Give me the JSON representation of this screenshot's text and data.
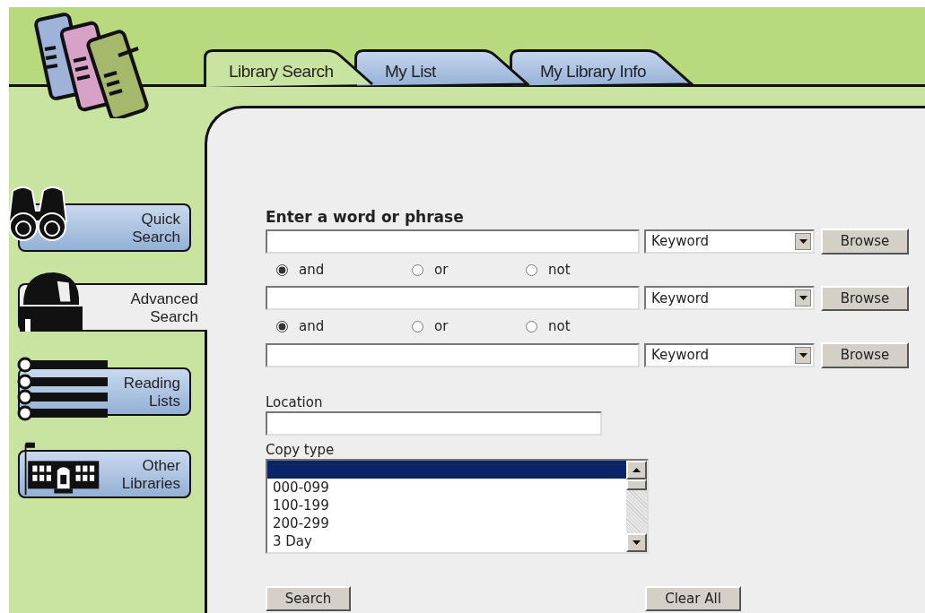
{
  "tabs": [
    {
      "label": "Library Search",
      "selected": true
    },
    {
      "label": "My List",
      "selected": false
    },
    {
      "label": "My Library Info",
      "selected": false
    }
  ],
  "sidebar": {
    "items": [
      {
        "label": "Quick Search",
        "kind": "binoculars",
        "selected": false
      },
      {
        "label": "Advanced Search",
        "kind": "observatory",
        "selected": true
      },
      {
        "label": "Reading Lists",
        "kind": "list",
        "selected": false
      },
      {
        "label": "Other Libraries",
        "kind": "building",
        "selected": false
      }
    ]
  },
  "search": {
    "heading": "Enter a word or phrase",
    "terms": [
      {
        "field_type": "Keyword",
        "button": "Browse"
      },
      {
        "field_type": "Keyword",
        "button": "Browse"
      },
      {
        "field_type": "Keyword",
        "button": "Browse"
      }
    ],
    "operators": [
      {
        "options": [
          {
            "label": "and",
            "selected": true
          },
          {
            "label": "or",
            "selected": false
          },
          {
            "label": "not",
            "selected": false
          }
        ]
      },
      {
        "options": [
          {
            "label": "and",
            "selected": true
          },
          {
            "label": "or",
            "selected": false
          },
          {
            "label": "not",
            "selected": false
          }
        ]
      }
    ]
  },
  "location": {
    "label": "Location"
  },
  "copy_type": {
    "label": "Copy type",
    "options": [
      {
        "selected": true
      },
      {
        "label": "000-099",
        "selected": false
      },
      {
        "label": "100-199",
        "selected": false
      },
      {
        "label": "200-299",
        "selected": false
      },
      {
        "label": "3 Day",
        "selected": false
      }
    ]
  },
  "buttons": [
    "Search",
    "Clear All"
  ]
}
